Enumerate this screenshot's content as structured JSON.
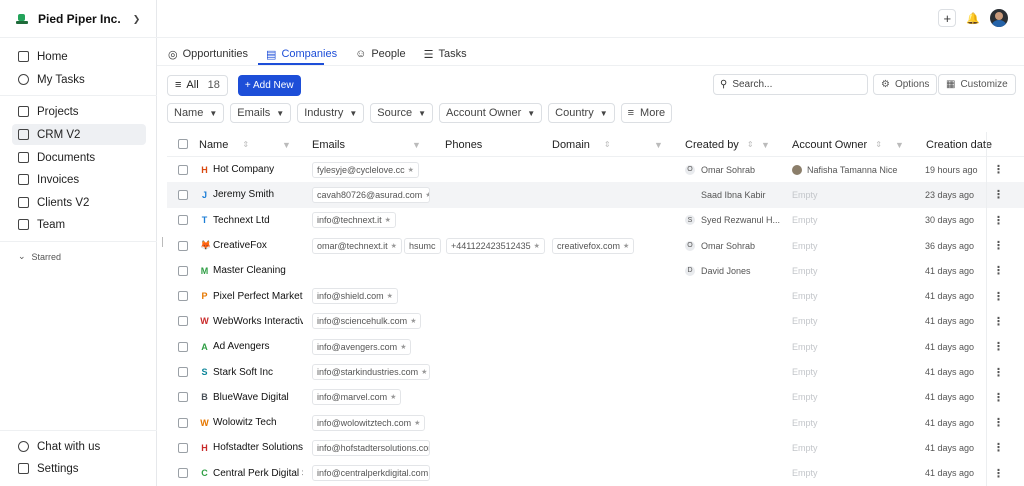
{
  "org": {
    "name": "Pied Piper Inc."
  },
  "sidebar": {
    "top_items": [
      {
        "label": "Home",
        "icon": "home-icon"
      },
      {
        "label": "My Tasks",
        "icon": "tasks-icon"
      }
    ],
    "items": [
      {
        "label": "Projects",
        "icon": "projects-icon"
      },
      {
        "label": "CRM V2",
        "icon": "crm-icon",
        "active": true
      },
      {
        "label": "Documents",
        "icon": "documents-icon"
      },
      {
        "label": "Invoices",
        "icon": "invoices-icon"
      },
      {
        "label": "Clients V2",
        "icon": "clients-icon"
      },
      {
        "label": "Team",
        "icon": "team-icon"
      }
    ],
    "starred_label": "Starred",
    "bottom_items": [
      {
        "label": "Chat with us",
        "icon": "chat-icon"
      },
      {
        "label": "Settings",
        "icon": "settings-icon"
      }
    ]
  },
  "tabs": [
    {
      "label": "Opportunities",
      "icon": "target-icon"
    },
    {
      "label": "Companies",
      "icon": "chart-icon",
      "active": true
    },
    {
      "label": "People",
      "icon": "person-icon"
    },
    {
      "label": "Tasks",
      "icon": "checklist-icon"
    }
  ],
  "toolbar": {
    "view_label": "All",
    "view_count": "18",
    "add_label": "+ Add New",
    "search_placeholder": "Search...",
    "options_label": "Options",
    "customize_label": "Customize"
  },
  "filters": [
    "Name",
    "Emails",
    "Industry",
    "Source",
    "Account Owner",
    "Country"
  ],
  "more_label": "More",
  "columns": {
    "name": "Name",
    "emails": "Emails",
    "phones": "Phones",
    "domain": "Domain",
    "created_by": "Created by",
    "account_owner": "Account Owner",
    "creation_date": "Creation date"
  },
  "colors": {
    "accent": "#1d4ed8"
  },
  "rows": [
    {
      "initial": "H",
      "initial_color": "#d9480f",
      "name": "Hot Company",
      "email": "fylesyje@cyclelove.cc",
      "email_star": true,
      "phone_a": "",
      "phone_b": "",
      "domain": "",
      "creator_initial": "O",
      "creator": "Omar Sohrab",
      "owner": "Nafisha Tamanna Nice",
      "owner_avatar": true,
      "date": "19 hours ago"
    },
    {
      "initial": "J",
      "initial_color": "#1c7ed6",
      "name": "Jeremy Smith",
      "email": "cavah80726@asurad.com",
      "email_star": true,
      "phone_a": "",
      "phone_b": "",
      "domain": "",
      "creator_initial": "",
      "creator": "Saad Ibna Kabir",
      "owner": "Empty",
      "owner_avatar": false,
      "date": "23 days ago",
      "highlight": true
    },
    {
      "initial": "T",
      "initial_color": "#1c7ed6",
      "name": "Technext Ltd",
      "email": "info@technext.it",
      "email_star": true,
      "phone_a": "",
      "phone_b": "",
      "domain": "",
      "creator_initial": "S",
      "creator": "Syed Rezwanul H...",
      "owner": "Empty",
      "owner_avatar": false,
      "date": "30 days ago"
    },
    {
      "initial": "🦊",
      "initial_color": "#e8590c",
      "name": "CreativeFox",
      "email": "omar@technext.it",
      "email_star": true,
      "phone_a": "hsumc",
      "phone_b": "+441122423512435",
      "domain": "creativefox.com",
      "creator_initial": "O",
      "creator": "Omar Sohrab",
      "owner": "Empty",
      "owner_avatar": false,
      "date": "36 days ago"
    },
    {
      "initial": "M",
      "initial_color": "#2f9e44",
      "name": "Master Cleaning",
      "email": "",
      "email_star": false,
      "phone_a": "",
      "phone_b": "",
      "domain": "",
      "creator_initial": "D",
      "creator": "David Jones",
      "owner": "Empty",
      "owner_avatar": false,
      "date": "41 days ago"
    },
    {
      "initial": "P",
      "initial_color": "#e67700",
      "name": "Pixel Perfect Marketing",
      "email": "info@shield.com",
      "email_star": true,
      "phone_a": "",
      "phone_b": "",
      "domain": "",
      "creator_initial": "",
      "creator": "",
      "owner": "Empty",
      "owner_avatar": false,
      "date": "41 days ago"
    },
    {
      "initial": "W",
      "initial_color": "#c92a2a",
      "name": "WebWorks Interactive",
      "email": "info@sciencehulk.com",
      "email_star": true,
      "phone_a": "",
      "phone_b": "",
      "domain": "",
      "creator_initial": "",
      "creator": "",
      "owner": "Empty",
      "owner_avatar": false,
      "date": "41 days ago"
    },
    {
      "initial": "A",
      "initial_color": "#2f9e44",
      "name": "Ad Avengers",
      "email": "info@avengers.com",
      "email_star": true,
      "phone_a": "",
      "phone_b": "",
      "domain": "",
      "creator_initial": "",
      "creator": "",
      "owner": "Empty",
      "owner_avatar": false,
      "date": "41 days ago"
    },
    {
      "initial": "S",
      "initial_color": "#0c8599",
      "name": "Stark Soft Inc",
      "email": "info@starkindustries.com",
      "email_star": true,
      "phone_a": "",
      "phone_b": "",
      "domain": "",
      "creator_initial": "",
      "creator": "",
      "owner": "Empty",
      "owner_avatar": false,
      "date": "41 days ago"
    },
    {
      "initial": "B",
      "initial_color": "#495057",
      "name": "BlueWave Digital",
      "email": "info@marvel.com",
      "email_star": true,
      "phone_a": "",
      "phone_b": "",
      "domain": "",
      "creator_initial": "",
      "creator": "",
      "owner": "Empty",
      "owner_avatar": false,
      "date": "41 days ago"
    },
    {
      "initial": "W",
      "initial_color": "#e67700",
      "name": "Wolowitz Tech",
      "email": "info@wolowitztech.com",
      "email_star": true,
      "phone_a": "",
      "phone_b": "",
      "domain": "",
      "creator_initial": "",
      "creator": "",
      "owner": "Empty",
      "owner_avatar": false,
      "date": "41 days ago"
    },
    {
      "initial": "H",
      "initial_color": "#c92a2a",
      "name": "Hofstadter Solutions",
      "email": "info@hofstadtersolutions.com",
      "email_star": false,
      "phone_a": "",
      "phone_b": "",
      "domain": "",
      "creator_initial": "",
      "creator": "",
      "owner": "Empty",
      "owner_avatar": false,
      "date": "41 days ago"
    },
    {
      "initial": "C",
      "initial_color": "#2f9e44",
      "name": "Central Perk Digital So",
      "email": "info@centralperkdigital.com",
      "email_star": true,
      "phone_a": "",
      "phone_b": "",
      "domain": "",
      "creator_initial": "",
      "creator": "",
      "owner": "Empty",
      "owner_avatar": false,
      "date": "41 days ago"
    }
  ]
}
